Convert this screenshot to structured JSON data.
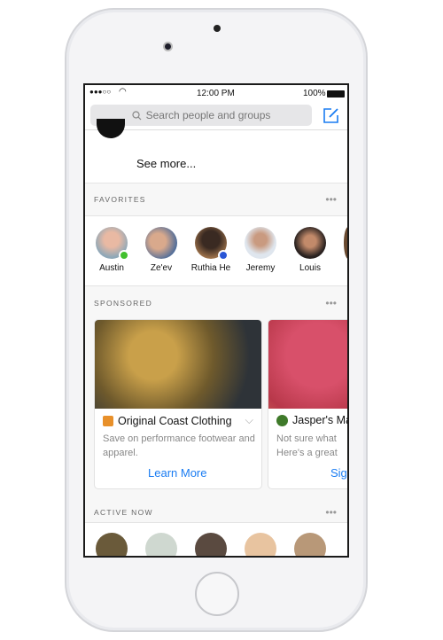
{
  "status": {
    "signal": "●●●○○",
    "time": "12:00 PM",
    "battery": "100%"
  },
  "search": {
    "placeholder": "Search people and groups",
    "icon": "search-icon",
    "compose_icon": "compose-icon"
  },
  "see_more": "See more...",
  "favorites": {
    "title": "FAVORITES",
    "people": [
      {
        "name": "Austin",
        "status": "online"
      },
      {
        "name": "Ze'ev"
      },
      {
        "name": "Ruthia He",
        "status": "messenger-badge"
      },
      {
        "name": "Jeremy"
      },
      {
        "name": "Louis"
      }
    ]
  },
  "sponsored": {
    "title": "SPONSORED",
    "cards": [
      {
        "brand": "Original Coast Clothing",
        "desc": "Save on performance footwear and apparel.",
        "cta": "Learn More"
      },
      {
        "brand": "Jasper's Ma",
        "desc": "Not sure what Here's a great",
        "cta": "Sig"
      }
    ]
  },
  "active_now": {
    "title": "ACTIVE NOW"
  },
  "colors": {
    "accent": "#1a7cf2",
    "online": "#42c02e"
  }
}
